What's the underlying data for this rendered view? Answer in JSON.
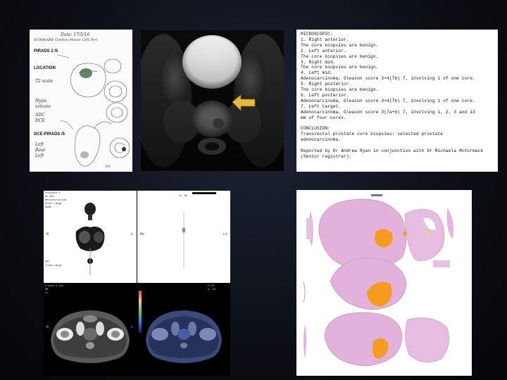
{
  "sketch": {
    "handwriting_top": [
      "Date: 17/5/16",
      "SUMMARY  Gordon Moore Left Peri"
    ],
    "pirads_label": "PIRADS 2 /5",
    "location_label": "LOCATION",
    "dce_label": "DCE-PIRADS /5",
    "notes": [
      "T2 scale",
      "ADC",
      "DCE",
      "Hypo",
      "volume",
      "Left",
      "Base",
      "Left"
    ]
  },
  "report": {
    "lines": [
      "MICROSCOPIC:",
      "1.  Right anterior.",
      "The core biopsies are benign.",
      "2.  Left anterior.",
      "The core biopsies are benign.",
      "3.  Right mid.",
      "The core biopsies are benign.",
      "4.  Left mid.",
      "Adenocarcinoma, Gleason score 3+4(7b) 7, involving 1 of one core.",
      "5.  Right posterior.",
      "The core biopsies are benign.",
      "6.  Left posterior.",
      "Adenocarcinoma, Gleason score 3+4(7b) 7, involving 1 of one core.",
      "7.  Left target.",
      "Adenocarcinoma, Gleason score 3(7a+b) 7, involving 1, 2, 3 and 13",
      "mm of four cores.",
      "",
      "CONCLUSION:",
      "Transrectal prostate core biopsies: selected prostate",
      "adenocarcinoma.",
      "",
      "Reported by Dr Andrew Ryan in conjunction with Dr Michaela McCormack",
      "(Senior registrar)."
    ]
  },
  "pet": {
    "top_left_text": [
      "Prostate 3",
      "Rt  Ant",
      "Reconstruction",
      "Orbit range",
      "AAAA",
      "PET",
      "Trans range"
    ],
    "top_right_text": [
      "A: 36",
      "Rt",
      "Lt"
    ],
    "bottom_text": [
      "S:bone 5 sky",
      "NM",
      "Ct",
      "F-50",
      "A: 50"
    ],
    "lr_labels": [
      "R",
      "L",
      "R",
      "L"
    ]
  },
  "colors": {
    "arrow": "#e8b83a",
    "tumor": "#f59b20",
    "tissue": "#e3b2dc"
  }
}
